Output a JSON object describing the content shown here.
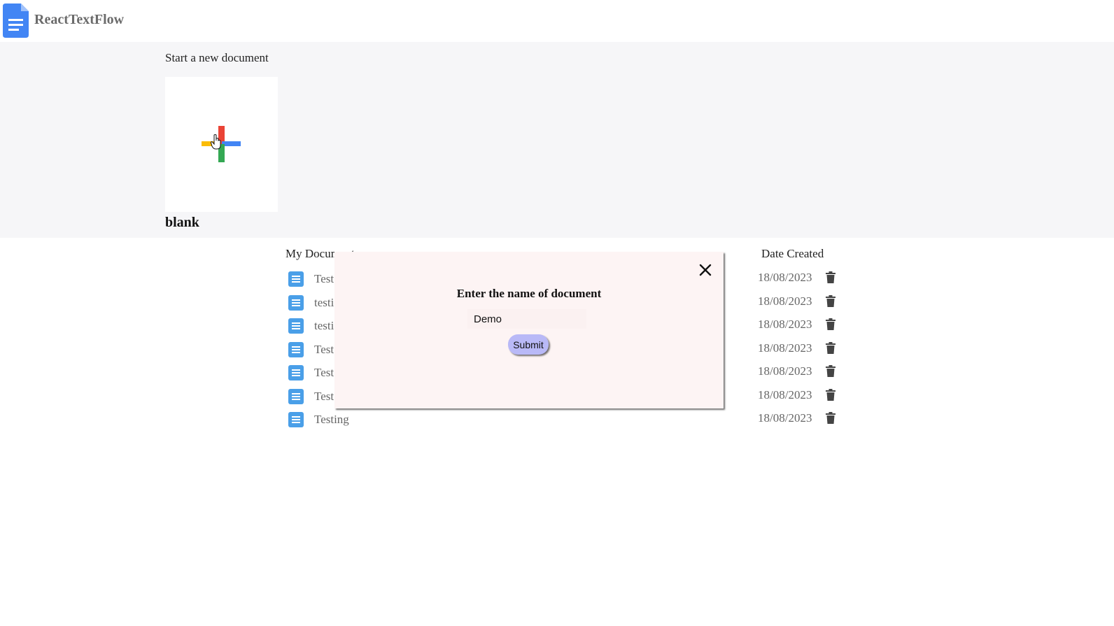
{
  "header": {
    "app_title": "ReactTextFlow",
    "logo_icon": "document-icon",
    "brand_color": "#4285f4"
  },
  "new_document": {
    "heading": "Start a new document",
    "blank_label": "blank",
    "plus_icon": "multicolor-plus-icon"
  },
  "documents": {
    "heading": "My Documents",
    "date_heading": "Date Created",
    "items": [
      {
        "name": "Test",
        "date": "18/08/2023"
      },
      {
        "name": "testi",
        "date": "18/08/2023"
      },
      {
        "name": "testi",
        "date": "18/08/2023"
      },
      {
        "name": "Test",
        "date": "18/08/2023"
      },
      {
        "name": "Test",
        "date": "18/08/2023"
      },
      {
        "name": "Test",
        "date": "18/08/2023"
      },
      {
        "name": "Testing",
        "date": "18/08/2023"
      }
    ],
    "row_icon": "document-icon",
    "delete_icon": "trash-icon"
  },
  "modal": {
    "title": "Enter the name of document",
    "input_value": "Demo",
    "submit_label": "Submit",
    "close_icon": "close-icon"
  },
  "colors": {
    "modal_bg": "#fdf4f4",
    "submit_bg": "#b9b9f7",
    "section_bg": "#f6f6f8"
  }
}
